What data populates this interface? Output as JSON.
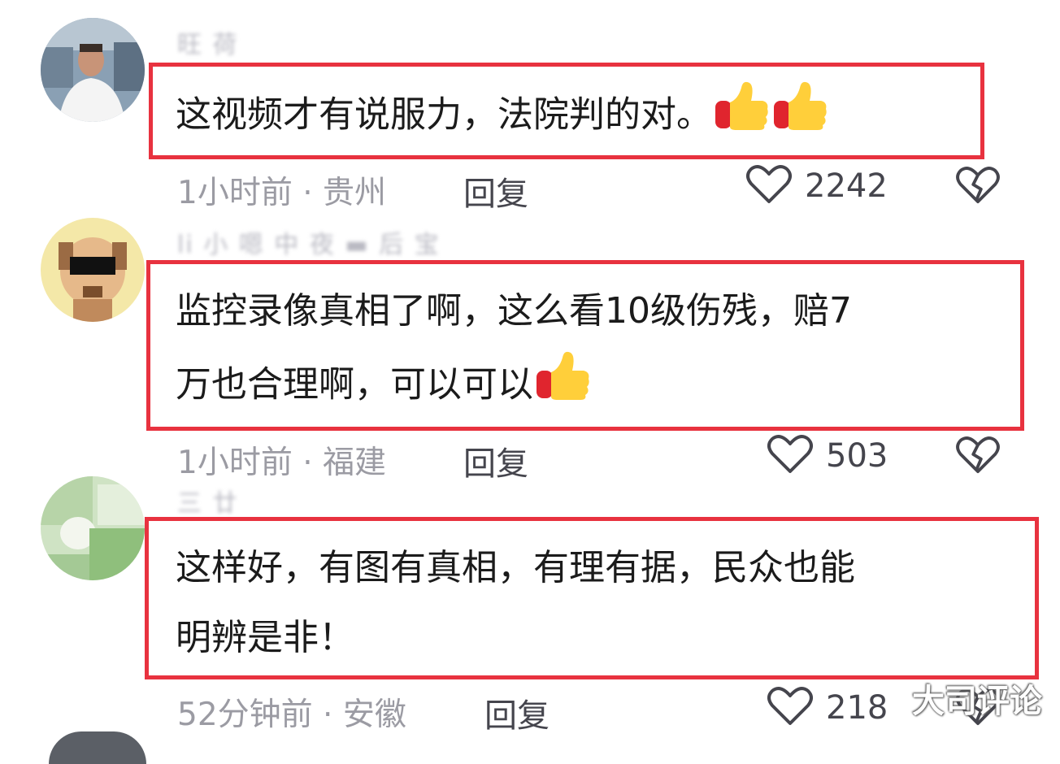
{
  "comments": [
    {
      "username": "旺 荷",
      "text": "这视频才有说服力，法院判的对。",
      "time": "1小时前",
      "location": "· 贵州",
      "reply": "回复",
      "likes": "2242",
      "emoji_count": 2
    },
    {
      "username": "li 小 嗯 中 夜 ▬ 后 宝",
      "text": "监控录像真相了啊，这么看10级伤残，赔7\n万也合理啊，可以可以",
      "time": "1小时前",
      "location": "· 福建",
      "reply": "回复",
      "likes": "503",
      "emoji_count": 1
    },
    {
      "username": "三 廿",
      "text": "这样好，有图有真相，有理有据，民众也能\n明辨是非！",
      "time": "52分钟前",
      "location": "· 安徽",
      "reply": "回复",
      "likes": "218",
      "emoji_count": 0
    }
  ],
  "icons": {
    "like": "heart-outline-icon",
    "dislike": "broken-heart-icon",
    "emoji": "thumbs-up-emoji"
  },
  "colors": {
    "highlight_border": "#e8323f",
    "meta_text": "#9b9ba3",
    "action_text": "#45454d"
  },
  "watermark": "大司评论"
}
